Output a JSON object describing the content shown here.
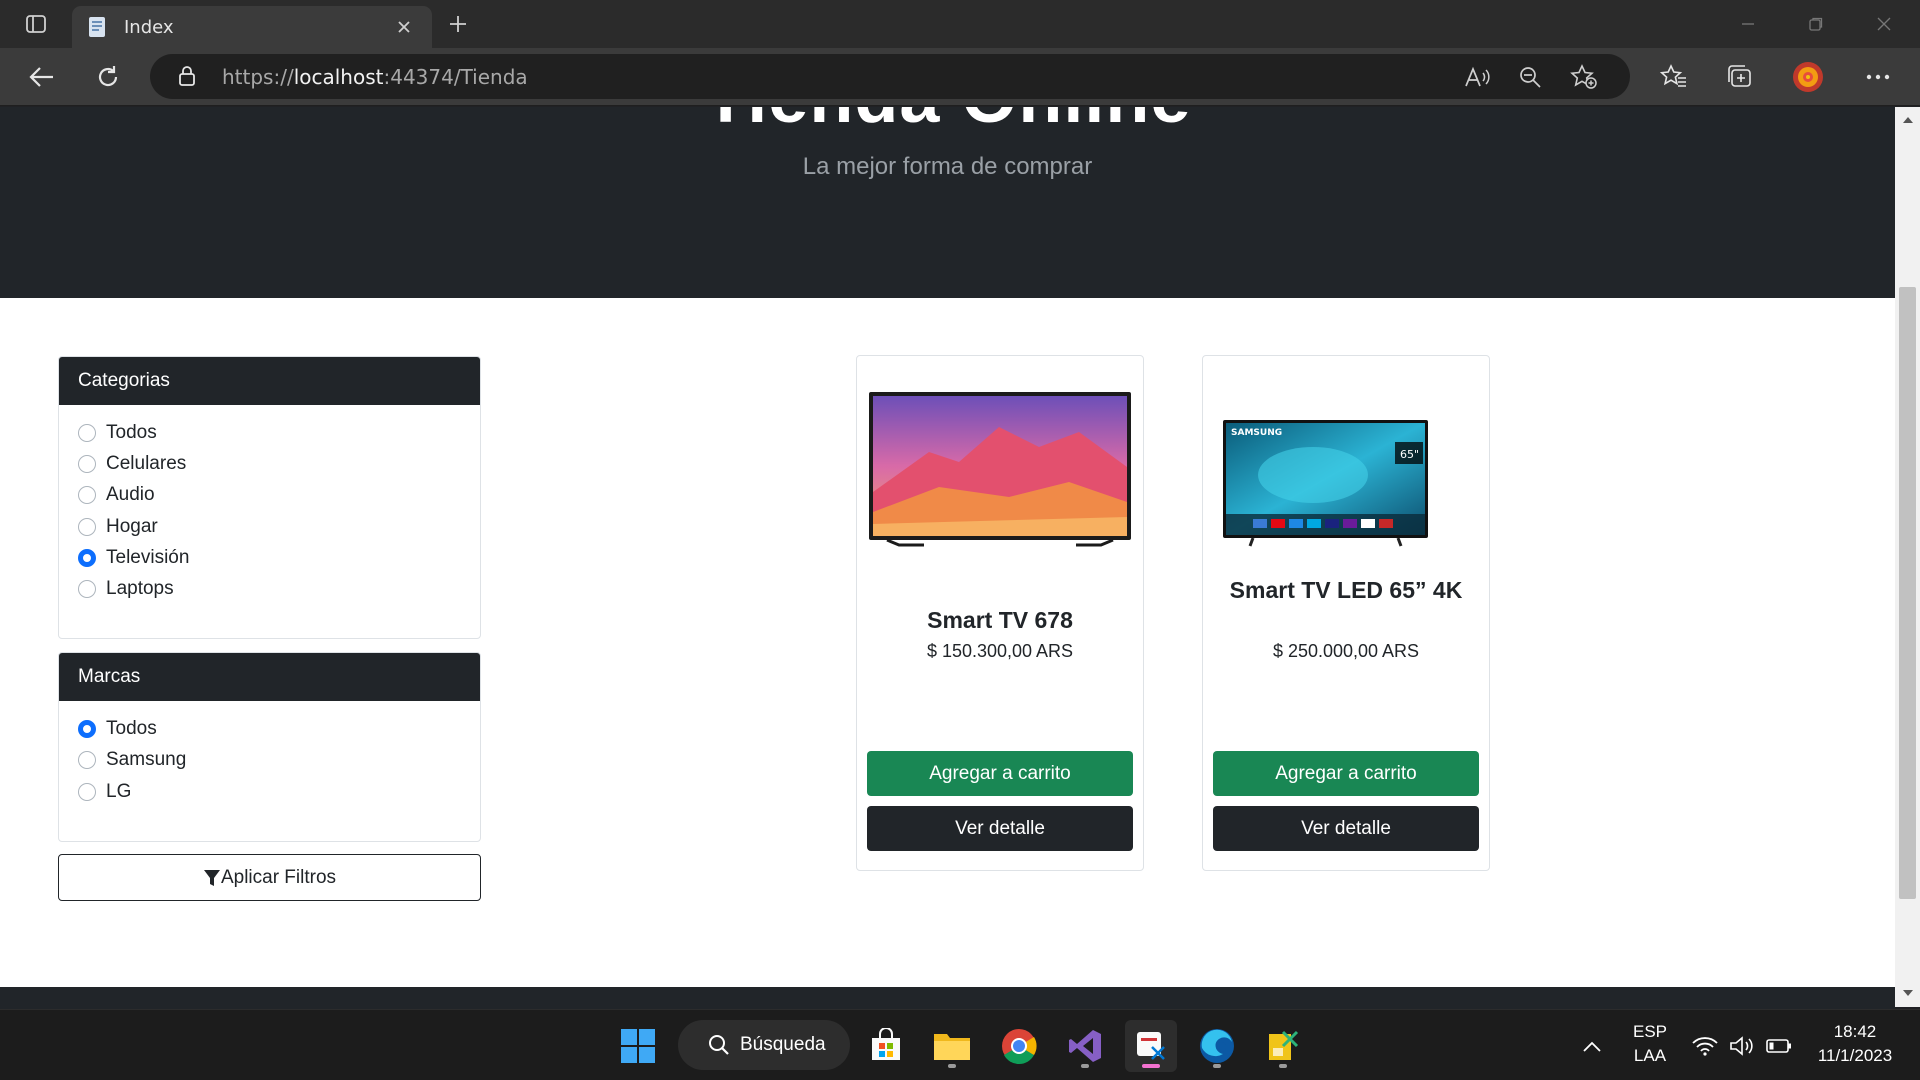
{
  "browser": {
    "tab_title": "Index",
    "url_scheme": "https://",
    "url_host": "localhost",
    "url_rest": ":44374/Tienda"
  },
  "hero": {
    "title": "Tienda Online",
    "subtitle": "La mejor forma de comprar"
  },
  "filters": {
    "categories_title": "Categorias",
    "categories": [
      {
        "label": "Todos",
        "checked": false
      },
      {
        "label": "Celulares",
        "checked": false
      },
      {
        "label": "Audio",
        "checked": false
      },
      {
        "label": "Hogar",
        "checked": false
      },
      {
        "label": "Televisión",
        "checked": true
      },
      {
        "label": "Laptops",
        "checked": false
      }
    ],
    "brands_title": "Marcas",
    "brands": [
      {
        "label": "Todos",
        "checked": true
      },
      {
        "label": "Samsung",
        "checked": false
      },
      {
        "label": "LG",
        "checked": false
      }
    ],
    "apply_label": "Aplicar Filtros"
  },
  "products": [
    {
      "name": "Smart TV 678",
      "price": "$ 150.300,00 ARS",
      "add_label": "Agregar a carrito",
      "detail_label": "Ver detalle"
    },
    {
      "name": "Smart TV LED 65” 4K",
      "price": "$ 250.000,00 ARS",
      "add_label": "Agregar a carrito",
      "detail_label": "Ver detalle",
      "image_brand": "SAMSUNG",
      "image_badge": "65\""
    }
  ],
  "taskbar": {
    "search_label": "Búsqueda",
    "lang_line1": "ESP",
    "lang_line2": "LAA",
    "time": "18:42",
    "date": "11/1/2023"
  },
  "colors": {
    "primary": "#0d6efd",
    "success": "#198754",
    "dark": "#212529"
  }
}
